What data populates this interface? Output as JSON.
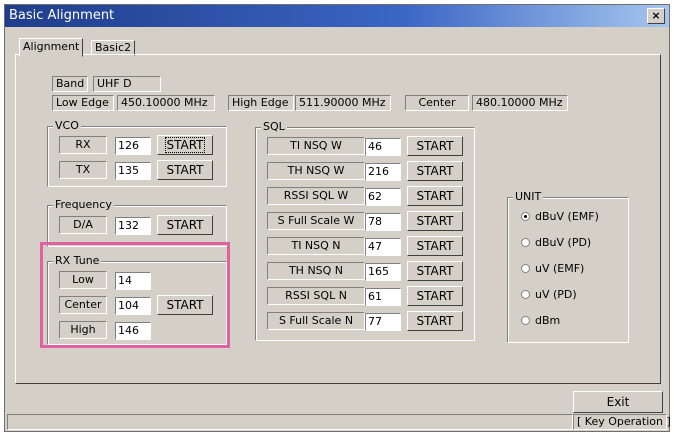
{
  "window": {
    "title": "Basic Alignment",
    "close": "×"
  },
  "tabs": [
    {
      "label": "Alignment"
    },
    {
      "label": "Basic2"
    }
  ],
  "band": {
    "label": "Band",
    "value": "UHF D"
  },
  "low_edge": {
    "label": "Low Edge",
    "value": "450.10000 MHz"
  },
  "high_edge": {
    "label": "High Edge",
    "value": "511.90000 MHz"
  },
  "center": {
    "label": "Center",
    "value": "480.10000 MHz"
  },
  "vco": {
    "legend": "VCO",
    "rows": [
      {
        "label": "RX",
        "value": "126",
        "button": "START"
      },
      {
        "label": "TX",
        "value": "135",
        "button": "START"
      }
    ]
  },
  "frequency": {
    "legend": "Frequency",
    "label": "D/A",
    "value": "132",
    "button": "START"
  },
  "rx_tune": {
    "legend": "RX Tune",
    "rows": [
      {
        "label": "Low",
        "value": "14"
      },
      {
        "label": "Center",
        "value": "104"
      },
      {
        "label": "High",
        "value": "146"
      }
    ],
    "button": "START"
  },
  "sql": {
    "legend": "SQL",
    "rows": [
      {
        "label": "TI NSQ W",
        "value": "46",
        "button": "START"
      },
      {
        "label": "TH NSQ W",
        "value": "216",
        "button": "START"
      },
      {
        "label": "RSSI SQL W",
        "value": "62",
        "button": "START"
      },
      {
        "label": "S Full Scale W",
        "value": "78",
        "button": "START"
      },
      {
        "label": "TI NSQ N",
        "value": "47",
        "button": "START"
      },
      {
        "label": "TH NSQ N",
        "value": "165",
        "button": "START"
      },
      {
        "label": "RSSI SQL N",
        "value": "61",
        "button": "START"
      },
      {
        "label": "S Full Scale N",
        "value": "77",
        "button": "START"
      }
    ]
  },
  "unit": {
    "legend": "UNIT",
    "options": [
      {
        "label": "dBuV (EMF)",
        "selected": true
      },
      {
        "label": "dBuV (PD)",
        "selected": false
      },
      {
        "label": "uV (EMF)",
        "selected": false
      },
      {
        "label": "uV (PD)",
        "selected": false
      },
      {
        "label": "dBm",
        "selected": false
      }
    ]
  },
  "exit_button": "Exit",
  "status": {
    "mode": "[ Key Operation ]"
  },
  "colors": {
    "title_bar": "#1f3d8a",
    "face": "#d4d0c8",
    "highlight": "#e060a0"
  }
}
